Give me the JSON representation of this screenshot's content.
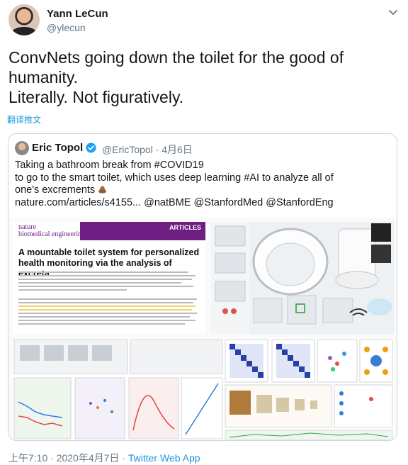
{
  "tweet": {
    "author_name": "Yann LeCun",
    "author_handle": "@ylecun",
    "text_lines": [
      "ConvNets going down the toilet for the good of",
      "humanity.",
      "Literally. Not figuratively."
    ],
    "translate_label": "翻译推文",
    "footer": "上午7:10 · 2020年4月7日 · ",
    "source": "Twitter Web App"
  },
  "quote": {
    "author_name": "Eric Topol",
    "author_handle": "@EricTopol · 4月6日",
    "lines": [
      "Taking a bathroom break from #COVID19",
      "to go to the smart toilet, which uses deep learning #AI to analyze all of",
      "one's excrements",
      "nature.com/articles/s4155... @natBME @StanfordMed @StanfordEng"
    ]
  },
  "figure": {
    "journal_line1": "nature",
    "journal_line2": "biomedical engineering",
    "articles_label": "ARTICLES",
    "paper_title": "A mountable toilet system for personalized health monitoring via the analysis of excreta"
  },
  "icons": [
    "more-chevron-icon",
    "verified-badge-icon",
    "poop-emoji-icon"
  ],
  "colors": {
    "link": "#1b95e0",
    "muted": "#657786",
    "border": "#ccd6dd",
    "journal": "#6f1e83"
  }
}
